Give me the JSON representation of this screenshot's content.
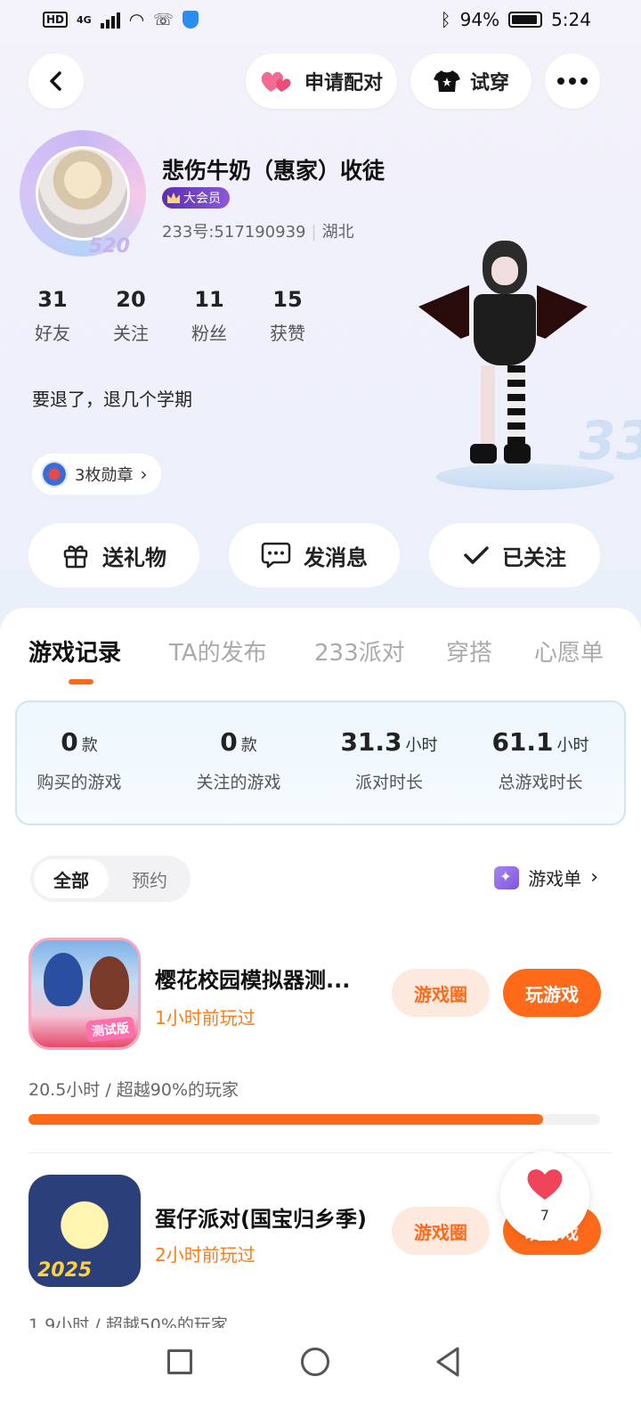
{
  "status_bar": {
    "hd": "HD",
    "network": "4G",
    "battery_percent": "94%",
    "time": "5:24"
  },
  "top_bar": {
    "pair_label": "申请配对",
    "try_on_label": "试穿"
  },
  "profile": {
    "name": "悲伤牛奶（惠家）收徒",
    "vip_label": "大会员",
    "uid": "233号:517190939",
    "location": "湖北",
    "avatar_badge": "520",
    "bio": "要退了，退几个学期",
    "medals_label": "3枚勋章",
    "stats": [
      {
        "value": "31",
        "label": "好友"
      },
      {
        "value": "20",
        "label": "关注"
      },
      {
        "value": "11",
        "label": "粉丝"
      },
      {
        "value": "15",
        "label": "获赞"
      }
    ]
  },
  "character": {
    "badge_text": "33"
  },
  "actions": {
    "gift": "送礼物",
    "message": "发消息",
    "followed": "已关注"
  },
  "tabs": [
    {
      "label": "游戏记录",
      "active": true
    },
    {
      "label": "TA的发布",
      "active": false
    },
    {
      "label": "233派对",
      "active": false
    },
    {
      "label": "穿搭",
      "active": false
    },
    {
      "label": "心愿单",
      "active": false
    }
  ],
  "summary": [
    {
      "value": "0",
      "unit": "款",
      "label": "购买的游戏"
    },
    {
      "value": "0",
      "unit": "款",
      "label": "关注的游戏"
    },
    {
      "value": "31.3",
      "unit": "小时",
      "label": "派对时长"
    },
    {
      "value": "61.1",
      "unit": "小时",
      "label": "总游戏时长"
    }
  ],
  "filter": {
    "all": "全部",
    "reserve": "预约",
    "game_list": "游戏单"
  },
  "games": [
    {
      "title": "樱花校园模拟器测...",
      "icon_tag": "测试版",
      "last_played": "1小时前玩过",
      "circle_label": "游戏圈",
      "play_label": "玩游戏",
      "play_stat": "20.5小时 / 超越90%的玩家",
      "progress": 0.9
    },
    {
      "title": "蛋仔派对(国宝归乡季)",
      "icon_tag": "2025",
      "last_played": "2小时前玩过",
      "circle_label": "游戏圈",
      "play_label": "玩游戏",
      "play_stat": "1.9小时 / 超越50%的玩家",
      "progress": 0.5
    }
  ],
  "like_float": {
    "count": "7"
  },
  "colors": {
    "accent": "#ff6a1a",
    "vip": "#6a3bc2",
    "heart": "#f0445a"
  }
}
